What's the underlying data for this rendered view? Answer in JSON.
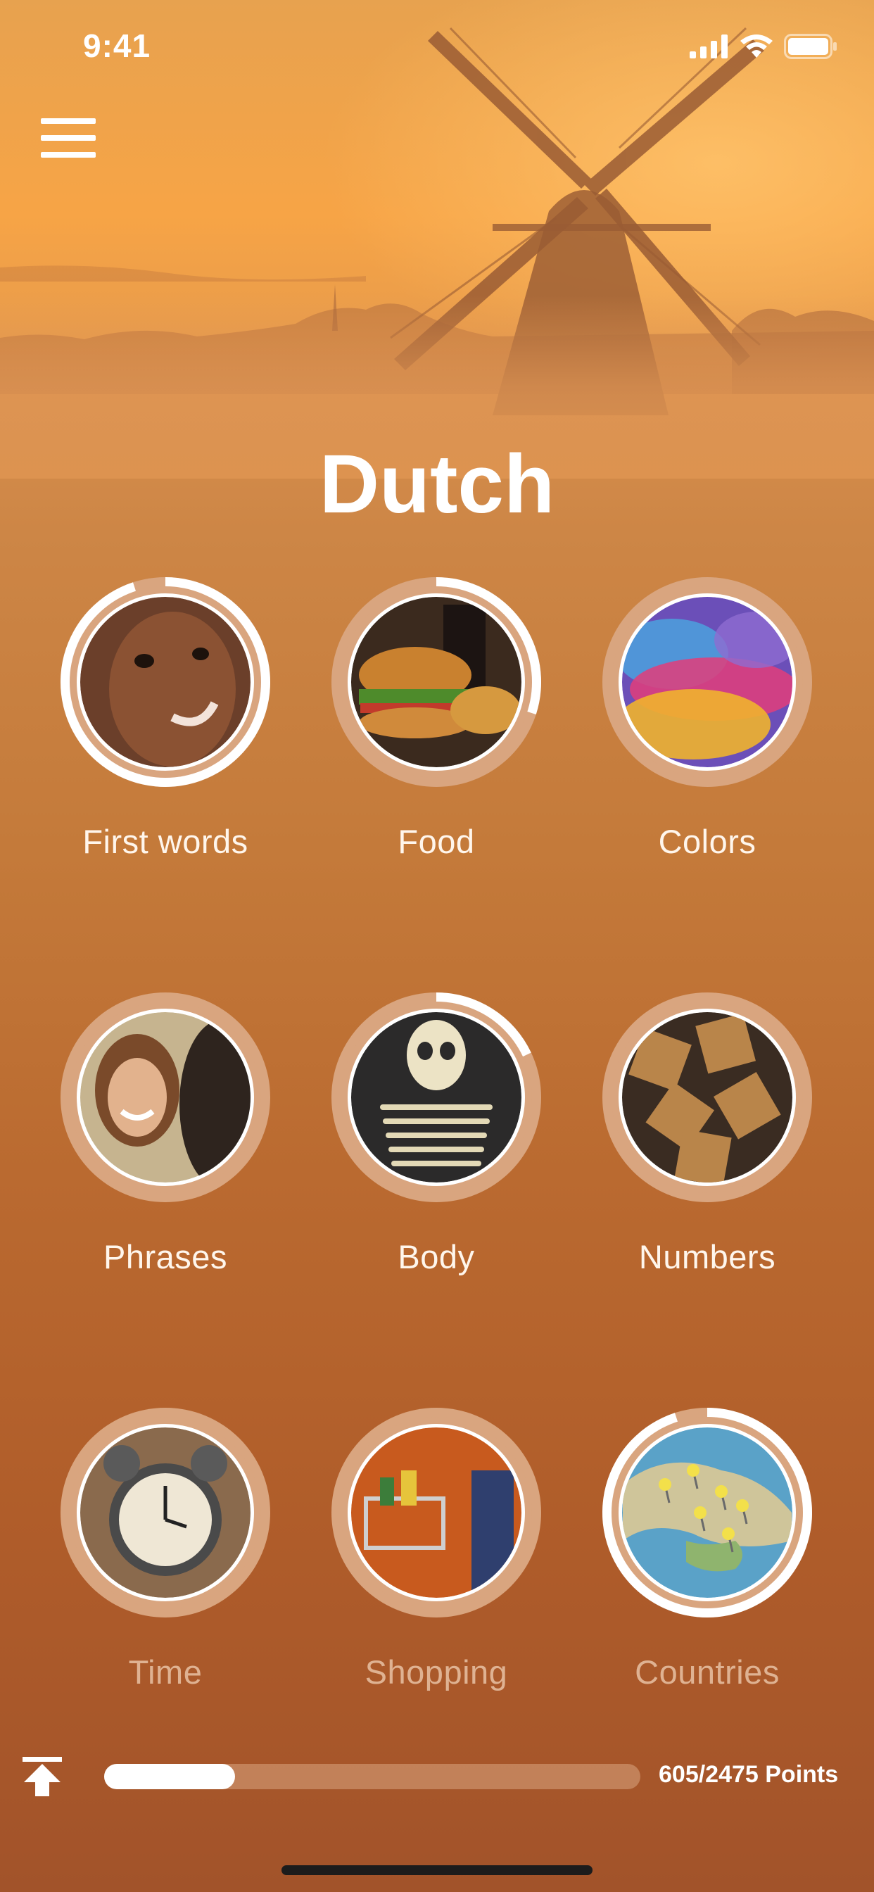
{
  "status_bar": {
    "time": "9:41",
    "icons": [
      "signal-icon",
      "wifi-icon",
      "battery-icon"
    ]
  },
  "header": {
    "menu_icon": "hamburger-icon",
    "hero_image": "windmill-sunrise-photo"
  },
  "title": "Dutch",
  "categories": [
    {
      "label": "First words",
      "image": "baby-photo",
      "progress": 0.95,
      "style": "normal"
    },
    {
      "label": "Food",
      "image": "burger-fries-photo",
      "progress": 0.3,
      "style": "normal"
    },
    {
      "label": "Colors",
      "image": "color-powder-photo",
      "progress": 0,
      "style": "normal"
    },
    {
      "label": "Phrases",
      "image": "smiling-woman-photo",
      "progress": 0,
      "style": "normal"
    },
    {
      "label": "Body",
      "image": "skeleton-photo",
      "progress": 0.18,
      "style": "normal"
    },
    {
      "label": "Numbers",
      "image": "wooden-numbers-photo",
      "progress": 0,
      "style": "normal"
    },
    {
      "label": "Time",
      "image": "alarm-clock-photo",
      "progress": 0,
      "style": "dim"
    },
    {
      "label": "Shopping",
      "image": "shopping-cart-photo",
      "progress": 0,
      "style": "dim"
    },
    {
      "label": "Countries",
      "image": "map-pins-photo",
      "progress": 0.95,
      "style": "dim"
    }
  ],
  "footer": {
    "upload_icon": "upload-icon",
    "progress": 0.244,
    "points_text": "605/2475 Points"
  },
  "colors": {
    "ring_track": "#d9a57f",
    "ring_fill": "#ffffff",
    "accent": "#c47a3a"
  }
}
